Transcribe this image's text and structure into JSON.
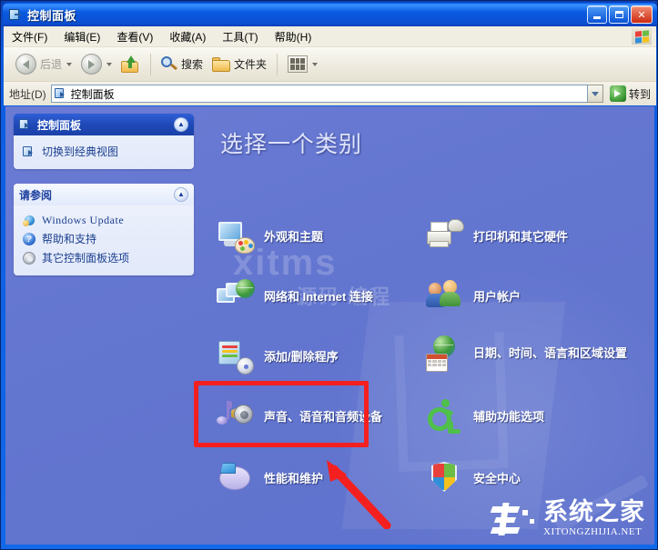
{
  "window": {
    "title": "控制面板",
    "title_icon": "control-panel-icon",
    "buttons": {
      "minimize": "最小化",
      "maximize": "最大化",
      "close": "关闭"
    }
  },
  "menu": {
    "items": [
      {
        "label": "文件(F)"
      },
      {
        "label": "编辑(E)"
      },
      {
        "label": "查看(V)"
      },
      {
        "label": "收藏(A)"
      },
      {
        "label": "工具(T)"
      },
      {
        "label": "帮助(H)"
      }
    ],
    "brand_icon": "windows-flag-icon"
  },
  "toolbar": {
    "back": "后退",
    "forward": "",
    "up": "",
    "search": "搜索",
    "folders": "文件夹",
    "views": ""
  },
  "address": {
    "label": "地址(D)",
    "value": "控制面板",
    "go_label": "转到"
  },
  "sidebar": {
    "panels": [
      {
        "title": "控制面板",
        "style": "dark",
        "links": [
          {
            "label": "切换到经典视图",
            "icon": "switch-view-icon"
          }
        ]
      },
      {
        "title": "请参阅",
        "style": "light",
        "links": [
          {
            "label": "Windows Update",
            "icon": "windows-update-icon"
          },
          {
            "label": "帮助和支持",
            "icon": "help-support-icon"
          },
          {
            "label": "其它控制面板选项",
            "icon": "other-options-icon"
          }
        ]
      }
    ]
  },
  "main": {
    "heading": "选择一个类别",
    "categories": [
      {
        "label": "外观和主题",
        "icon": "appearance-themes-icon",
        "col": 0,
        "row": 0
      },
      {
        "label": "网络和 Internet 连接",
        "icon": "network-internet-icon",
        "col": 0,
        "row": 1
      },
      {
        "label": "添加/删除程序",
        "icon": "add-remove-programs-icon",
        "col": 0,
        "row": 2
      },
      {
        "label": "声音、语音和音频设备",
        "icon": "sound-speech-audio-icon",
        "col": 0,
        "row": 3
      },
      {
        "label": "性能和维护",
        "icon": "performance-maintenance-icon",
        "col": 0,
        "row": 4,
        "highlighted": true
      },
      {
        "label": "打印机和其它硬件",
        "icon": "printers-hardware-icon",
        "col": 1,
        "row": 0
      },
      {
        "label": "用户帐户",
        "icon": "user-accounts-icon",
        "col": 1,
        "row": 1
      },
      {
        "label": "日期、时间、语言和区域设置",
        "icon": "date-time-language-icon",
        "col": 1,
        "row": 2
      },
      {
        "label": "辅助功能选项",
        "icon": "accessibility-options-icon",
        "col": 1,
        "row": 3
      },
      {
        "label": "安全中心",
        "icon": "security-center-icon",
        "col": 1,
        "row": 4
      }
    ]
  },
  "annotations": {
    "highlight_box_color": "#f42020",
    "arrow_color": "#f42020",
    "arrow_points_to": "性能和维护"
  },
  "watermarks": {
    "center_text": "xitms",
    "center_sub": "源码 编程",
    "brand_name": "系统之家",
    "brand_url": "XITONGZHIJIA.NET"
  },
  "colors": {
    "titlebar_blue": "#0a5ae0",
    "client_background": "#6678d2",
    "panel_header_dark": "#1f49b8",
    "link_text": "#1b3f8f",
    "accent_red": "#f42020",
    "go_green": "#3f9b38"
  }
}
